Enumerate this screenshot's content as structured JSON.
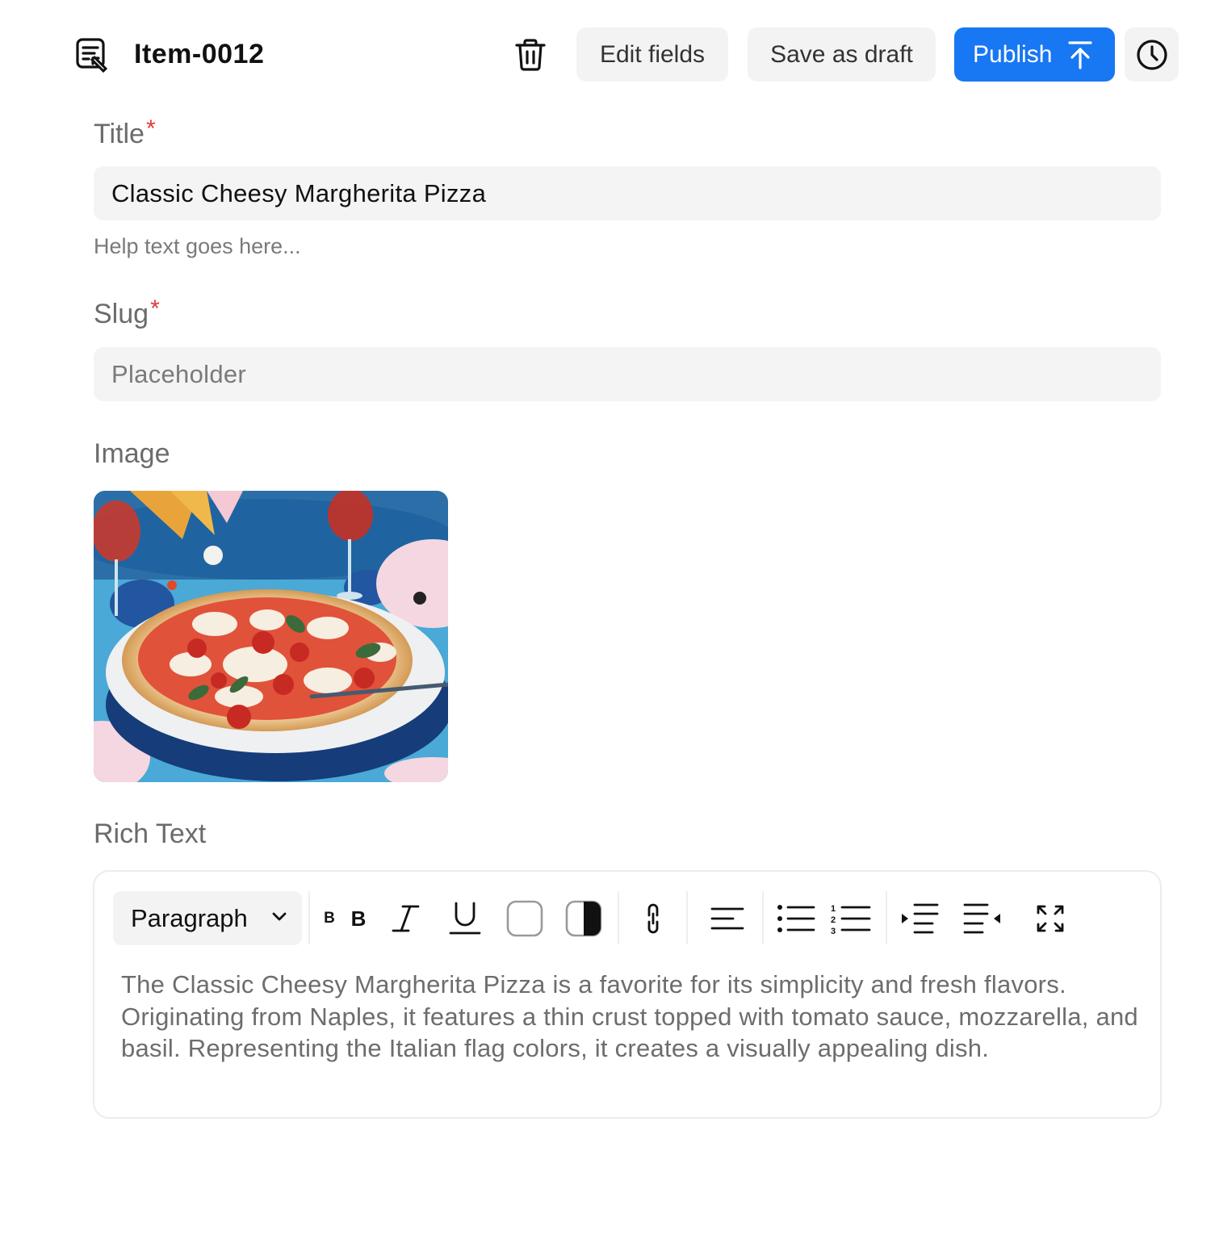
{
  "header": {
    "icon": "document-edit-icon",
    "title": "Item-0012",
    "delete_icon": "trash-icon",
    "edit_fields_label": "Edit fields",
    "save_draft_label": "Save as draft",
    "publish_label": "Publish",
    "publish_icon": "arrow-up-to-line-icon",
    "history_icon": "clock-icon",
    "accent_color": "#1877f2"
  },
  "fields": {
    "title": {
      "label": "Title",
      "required_mark": "*",
      "value": "Classic Cheesy Margherita Pizza",
      "help_text": "Help text goes here..."
    },
    "slug": {
      "label": "Slug",
      "required_mark": "*",
      "placeholder": "Placeholder"
    },
    "image": {
      "label": "Image"
    },
    "rich_text": {
      "label": "Rich Text",
      "block_type": "Paragraph",
      "toolbar_icons": [
        "font-size-small-icon",
        "bold-icon",
        "italic-icon",
        "underline-icon",
        "text-color-icon",
        "highlight-color-icon",
        "link-icon",
        "align-left-icon",
        "bullet-list-icon",
        "numbered-list-icon",
        "indent-icon",
        "outdent-icon",
        "fullscreen-icon"
      ],
      "toolbar_text": {
        "small_b": "B",
        "bold_b": "B"
      },
      "content": "The Classic Cheesy Margherita Pizza is a favorite for its simplicity and fresh flavors. Originating from Naples, it features a thin crust topped with tomato sauce, mozzarella, and basil. Representing the Italian flag colors, it creates a visually appealing dish."
    }
  }
}
